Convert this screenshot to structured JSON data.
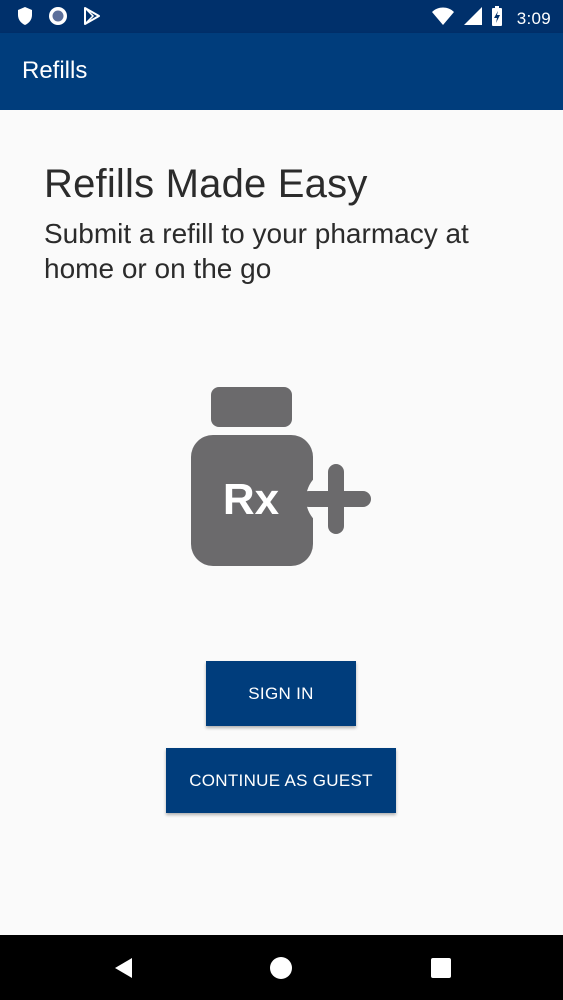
{
  "status_bar": {
    "time": "3:09",
    "left_icons": [
      "shield-icon",
      "circle-app-icon",
      "play-store-icon"
    ],
    "right_icons": [
      "wifi-icon",
      "cellular-signal-icon",
      "battery-charging-icon"
    ]
  },
  "app_bar": {
    "title": "Refills"
  },
  "main": {
    "headline": "Refills Made Easy",
    "subheadline": "Submit a refill to your pharmacy at home or on the go",
    "illustration": {
      "icon": "rx-bottle-plus-icon",
      "label": "Rx",
      "color": "#6b6a6c"
    },
    "buttons": {
      "sign_in": "SIGN IN",
      "continue_guest": "CONTINUE AS GUEST"
    }
  },
  "nav_bar": {
    "items": [
      "back-icon",
      "home-icon",
      "recents-icon"
    ]
  },
  "colors": {
    "primary": "#003d7c",
    "status_bar": "#00306b",
    "background": "#fafafa",
    "text": "#2b2b2b"
  }
}
